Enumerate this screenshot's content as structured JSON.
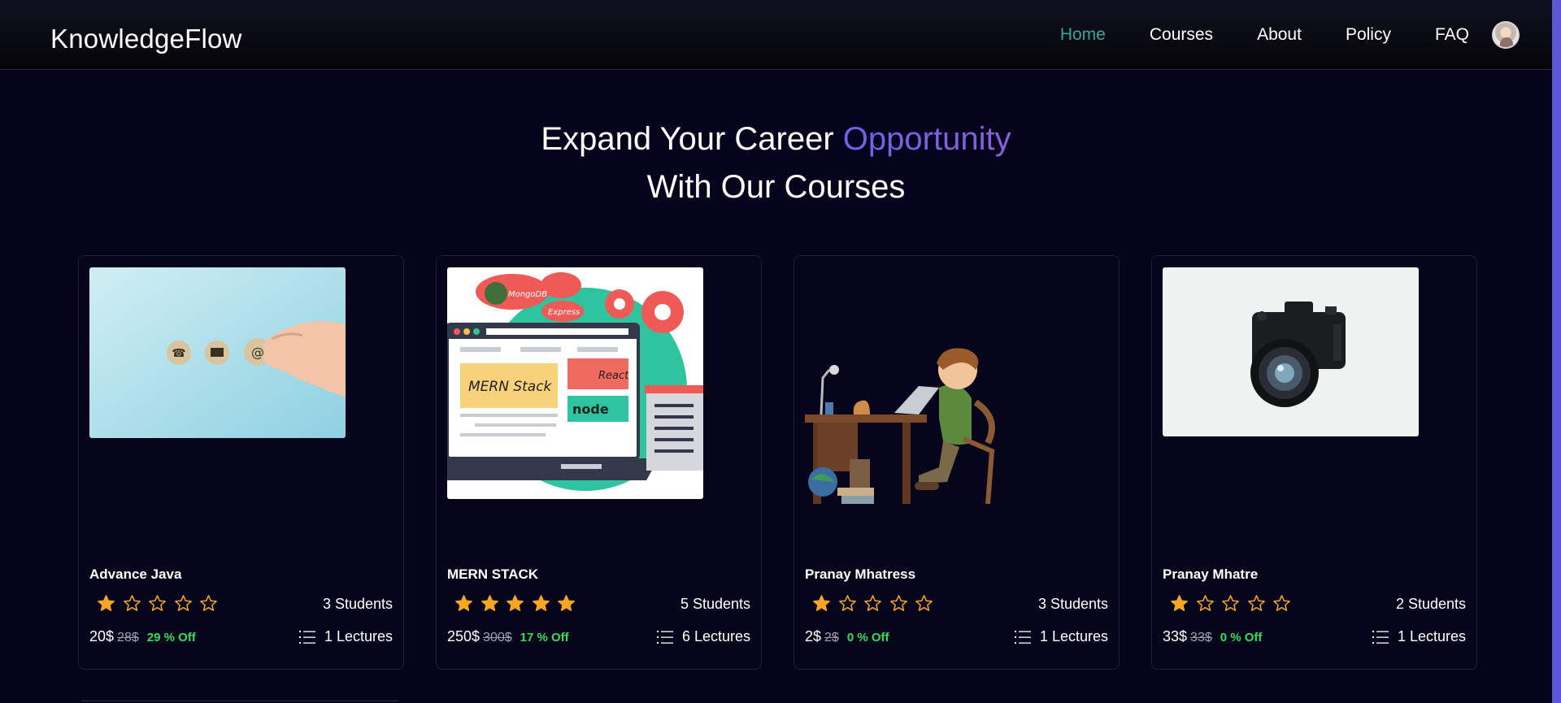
{
  "nav": {
    "brand": "KnowledgeFlow",
    "links": [
      {
        "label": "Home",
        "active": true
      },
      {
        "label": "Courses",
        "active": false
      },
      {
        "label": "About",
        "active": false
      },
      {
        "label": "Policy",
        "active": false
      },
      {
        "label": "FAQ",
        "active": false
      }
    ],
    "avatar_icon": "user-avatar-icon"
  },
  "hero": {
    "line1_prefix": "Expand Your Career",
    "line1_accent": "Opportunity",
    "line2": "With Our Courses"
  },
  "courses": [
    {
      "title": "Advance Java",
      "rating": 1,
      "max_rating": 5,
      "students": "3 Students",
      "price": "20$",
      "old_price": "28$",
      "discount": "29 % Off",
      "lectures": "1 Lectures",
      "thumbnail": "contact-icons-photo"
    },
    {
      "title": "MERN STACK",
      "rating": 5,
      "max_rating": 5,
      "students": "5 Students",
      "price": "250$",
      "old_price": "300$",
      "discount": "17 % Off",
      "lectures": "6 Lectures",
      "thumbnail": "mern-stack-illustration",
      "thumbnail_labels": {
        "mongodb": "MongoDB",
        "express": "Express",
        "mern": "MERN Stack",
        "react": "React",
        "node": "node"
      }
    },
    {
      "title": "Pranay Mhatress",
      "rating": 1,
      "max_rating": 5,
      "students": "3 Students",
      "price": "2$",
      "old_price": "2$",
      "discount": "0 % Off",
      "lectures": "1 Lectures",
      "thumbnail": "boy-at-desk-illustration"
    },
    {
      "title": "Pranay Mhatre",
      "rating": 1,
      "max_rating": 5,
      "students": "2 Students",
      "price": "33$",
      "old_price": "33$",
      "discount": "0 % Off",
      "lectures": "1 Lectures",
      "thumbnail": "camera-photo"
    }
  ],
  "colors": {
    "background": "#05041c",
    "nav_active": "#3aa39c",
    "accent_gradient": [
      "#6d63e6",
      "#8b5fd8"
    ],
    "star": "#f5a623",
    "discount": "#2ee05a",
    "scrollbar": "#5b57d6"
  }
}
